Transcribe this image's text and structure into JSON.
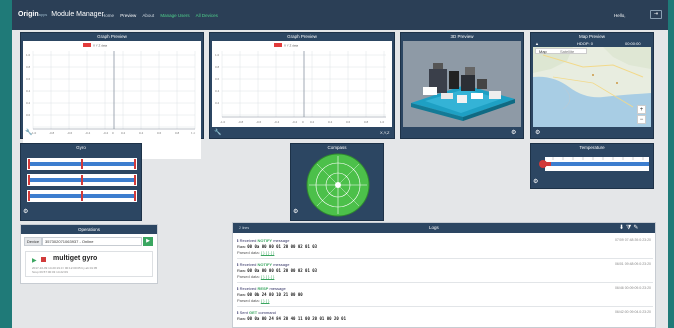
{
  "app": {
    "brand": "Origin",
    "brand_sub": "apps",
    "title": "Module Manager",
    "nav": [
      "Home",
      "Preview",
      "About",
      "Manage Users",
      "All Devices"
    ],
    "greeting": "Hello,",
    "logout_icon": "logout-icon"
  },
  "graph1": {
    "title": "Graph Preview",
    "legend": "X Y Z data",
    "axis_label": "X,Y,Z"
  },
  "graph2": {
    "title": "Graph Preview",
    "legend": "X Y Z data",
    "axis_label": "X,Y,Z"
  },
  "preview3d": {
    "title": "3D Preview"
  },
  "map": {
    "title": "Map Preview",
    "hdop": "HDOP: 0",
    "time": "00:00:00",
    "tab_map": "Map",
    "tab_satellite": "Satellite",
    "zoom_in": "+",
    "zoom_out": "−"
  },
  "gyro": {
    "title": "Gyro"
  },
  "compass": {
    "title": "Compass"
  },
  "temperature": {
    "title": "Temperature"
  },
  "operations": {
    "title": "Operations",
    "device_label": "Device",
    "device_value": "357302071063937 - Online",
    "go_label": "▶",
    "command": "multiget gyro",
    "meta_line1": "2017-10-09 14:20:19.0 / 00:12:00:05 by ab:01:05",
    "meta_line2": "Ssvp 09:57:00:03 14:22:09"
  },
  "logs": {
    "title": "Logs",
    "filter_label": "2 lines",
    "entries": [
      {
        "l1_pre": "Received ",
        "l1_kw": "NOTIFY",
        "l1_post": " message",
        "raw_label": "Raw:",
        "raw": "00 0a 00 00 01 20 00 02 01 03",
        "parsed_label": "Parsed data:",
        "parsed": "{ } { } { }",
        "ts": "07/09 07:48:39.0:23:20"
      },
      {
        "l1_pre": "Received ",
        "l1_kw": "NOTIFY",
        "l1_post": " message",
        "raw_label": "Raw:",
        "raw": "00 0a 00 00 01 20 00 02 01 03",
        "parsed_label": "Parsed data:",
        "parsed": "{ } { } { }",
        "ts": "06/01 09:48:09.0:23:20"
      },
      {
        "l1_pre": "Received ",
        "l1_kw": "RESP",
        "l1_post": " message",
        "raw_label": "Raw:",
        "raw": "00 0b 24 80 10 21 00 00",
        "parsed_label": "Parsed data:",
        "parsed": "{ } { }",
        "ts": "06/46 00:09:09.0:23:20"
      },
      {
        "l1_pre": "Sent ",
        "l1_kw": "GET",
        "l1_post": " command",
        "raw_label": "Raw:",
        "raw": "00 0a 00 24 84 20 40 11 00 20 01 00 20 01",
        "parsed_label": "",
        "parsed": "",
        "ts": "06/42:00 09:04.0:23:20"
      }
    ]
  }
}
